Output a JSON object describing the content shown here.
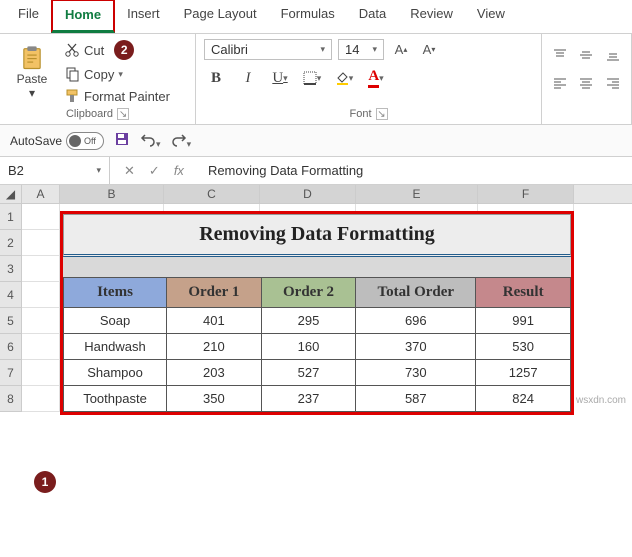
{
  "menubar": {
    "items": [
      "File",
      "Home",
      "Insert",
      "Page Layout",
      "Formulas",
      "Data",
      "Review",
      "View"
    ],
    "active_index": 1
  },
  "ribbon": {
    "clipboard": {
      "paste": "Paste",
      "cut": "Cut",
      "copy": "Copy",
      "format_painter": "Format Painter",
      "group_name": "Clipboard",
      "badge": "2"
    },
    "font": {
      "family": "Calibri",
      "size": "14",
      "group_name": "Font"
    }
  },
  "qat": {
    "autosave_label": "AutoSave",
    "autosave_state": "Off"
  },
  "namebox": {
    "ref": "B2"
  },
  "formula_bar": {
    "value": "Removing Data Formatting"
  },
  "columns": [
    "A",
    "B",
    "C",
    "D",
    "E",
    "F"
  ],
  "rows": [
    "1",
    "2",
    "3",
    "4",
    "5",
    "6",
    "7",
    "8"
  ],
  "chart_data": {
    "type": "table",
    "title": "Removing Data Formatting",
    "headers": [
      "Items",
      "Order 1",
      "Order 2",
      "Total Order",
      "Result"
    ],
    "rows": [
      [
        "Soap",
        "401",
        "295",
        "696",
        "991"
      ],
      [
        "Handwash",
        "210",
        "160",
        "370",
        "530"
      ],
      [
        "Shampoo",
        "203",
        "527",
        "730",
        "1257"
      ],
      [
        "Toothpaste",
        "350",
        "237",
        "587",
        "824"
      ]
    ]
  },
  "badge1": "1",
  "watermark": "wsxdn.com"
}
